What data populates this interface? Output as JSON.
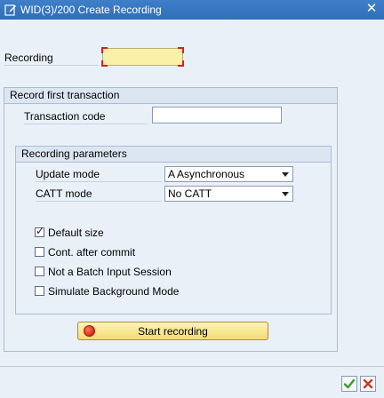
{
  "window": {
    "title": "WID(3)/200 Create Recording",
    "close_symbol": "✕"
  },
  "recording": {
    "label": "Recording",
    "value": ""
  },
  "first_transaction": {
    "group_title": "Record first transaction",
    "tcode_label": "Transaction code",
    "tcode_value": ""
  },
  "parameters": {
    "group_title": "Recording parameters",
    "update_mode_label": "Update mode",
    "update_mode_value": "A Asynchronous",
    "catt_mode_label": "CATT mode",
    "catt_mode_value": "No CATT",
    "checkboxes": [
      {
        "label": "Default size",
        "checked": true
      },
      {
        "label": "Cont. after commit",
        "checked": false
      },
      {
        "label": "Not a Batch Input Session",
        "checked": false
      },
      {
        "label": "Simulate Background Mode",
        "checked": false
      }
    ]
  },
  "start_button": {
    "label": "Start recording",
    "icon": "record-icon"
  },
  "footer": {
    "ok_icon": "checkmark-icon",
    "cancel_icon": "cancel-x-icon"
  },
  "colors": {
    "titlebar": "#3e7fc8",
    "background": "#e9f0f8",
    "required_field": "#fbf0a8",
    "button_yellow": "#f4dc72",
    "ok_green": "#3a9a2c",
    "cancel_red": "#c8391f"
  }
}
